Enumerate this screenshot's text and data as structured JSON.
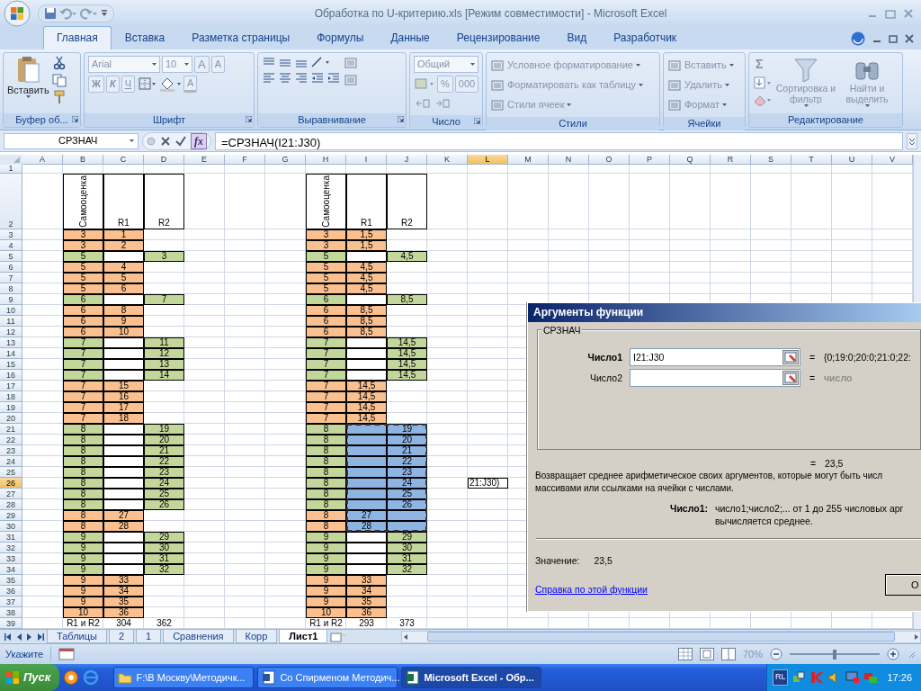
{
  "window": {
    "title": "Обработка по U-критерию.xls  [Режим совместимости] - Microsoft Excel"
  },
  "tabs": [
    {
      "label": "Главная",
      "selected": true
    },
    {
      "label": "Вставка",
      "selected": false
    },
    {
      "label": "Разметка страницы",
      "selected": false
    },
    {
      "label": "Формулы",
      "selected": false
    },
    {
      "label": "Данные",
      "selected": false
    },
    {
      "label": "Рецензирование",
      "selected": false
    },
    {
      "label": "Вид",
      "selected": false
    },
    {
      "label": "Разработчик",
      "selected": false
    }
  ],
  "ribbon": {
    "disabled": true,
    "clipboard": {
      "label": "Буфер об...",
      "paste": "Вставить"
    },
    "font": {
      "label": "Шрифт",
      "name": "Arial",
      "size": "10",
      "grow": "A",
      "shrink": "A",
      "bold": "Ж",
      "italic": "К",
      "underline": "Ч",
      "letter_button": "A"
    },
    "alignment": {
      "label": "Выравнивание"
    },
    "number": {
      "label": "Число",
      "format": "Общий",
      "percent": "%",
      "thousands": "000"
    },
    "styles": {
      "label": "Стили",
      "items": [
        "Условное форматирование",
        "Форматировать как таблицу",
        "Стили ячеек"
      ]
    },
    "cells": {
      "label": "Ячейки",
      "items": [
        "Вставить",
        "Удалить",
        "Формат"
      ]
    },
    "editing": {
      "label": "Редактирование",
      "sum": "Σ",
      "sort": "Сортировка и фильтр",
      "find": "Найти и выделить"
    }
  },
  "formula_bar": {
    "name_box": "СРЗНАЧ",
    "fx": "fx",
    "formula": "=СРЗНАЧ(I21:J30)"
  },
  "sheet": {
    "columns": [
      {
        "label": "A",
        "selected": false
      },
      {
        "label": "B",
        "selected": false
      },
      {
        "label": "C",
        "selected": false
      },
      {
        "label": "D",
        "selected": false
      },
      {
        "label": "E",
        "selected": false
      },
      {
        "label": "F",
        "selected": false
      },
      {
        "label": "G",
        "selected": false
      },
      {
        "label": "H",
        "selected": false
      },
      {
        "label": "I",
        "selected": false
      },
      {
        "label": "J",
        "selected": false
      },
      {
        "label": "K",
        "selected": false
      },
      {
        "label": "L",
        "selected": true
      },
      {
        "label": "M",
        "selected": false
      },
      {
        "label": "N",
        "selected": false
      },
      {
        "label": "O",
        "selected": false
      },
      {
        "label": "P",
        "selected": false
      },
      {
        "label": "Q",
        "selected": false
      },
      {
        "label": "R",
        "selected": false
      },
      {
        "label": "S",
        "selected": false
      },
      {
        "label": "T",
        "selected": false
      },
      {
        "label": "U",
        "selected": false
      },
      {
        "label": "V",
        "selected": false
      }
    ],
    "rows": [
      {
        "label": "1",
        "selected": false
      },
      {
        "label": "2",
        "selected": false
      },
      {
        "label": "3",
        "selected": false
      },
      {
        "label": "4",
        "selected": false
      },
      {
        "label": "5",
        "selected": false
      },
      {
        "label": "6",
        "selected": false
      },
      {
        "label": "7",
        "selected": false
      },
      {
        "label": "8",
        "selected": false
      },
      {
        "label": "9",
        "selected": false
      },
      {
        "label": "10",
        "selected": false
      },
      {
        "label": "11",
        "selected": false
      },
      {
        "label": "12",
        "selected": false
      },
      {
        "label": "13",
        "selected": false
      },
      {
        "label": "14",
        "selected": false
      },
      {
        "label": "15",
        "selected": false
      },
      {
        "label": "16",
        "selected": false
      },
      {
        "label": "17",
        "selected": false
      },
      {
        "label": "18",
        "selected": false
      },
      {
        "label": "19",
        "selected": false
      },
      {
        "label": "20",
        "selected": false
      },
      {
        "label": "21",
        "selected": false
      },
      {
        "label": "22",
        "selected": false
      },
      {
        "label": "23",
        "selected": false
      },
      {
        "label": "24",
        "selected": false
      },
      {
        "label": "25",
        "selected": false
      },
      {
        "label": "26",
        "selected": true
      },
      {
        "label": "27",
        "selected": false
      },
      {
        "label": "28",
        "selected": false
      },
      {
        "label": "29",
        "selected": false
      },
      {
        "label": "30",
        "selected": false
      },
      {
        "label": "31",
        "selected": false
      },
      {
        "label": "32",
        "selected": false
      },
      {
        "label": "33",
        "selected": false
      },
      {
        "label": "34",
        "selected": false
      },
      {
        "label": "35",
        "selected": false
      },
      {
        "label": "36",
        "selected": false
      },
      {
        "label": "37",
        "selected": false
      },
      {
        "label": "38",
        "selected": false
      },
      {
        "label": "39",
        "selected": false
      }
    ],
    "cell_echo": "21:J30)"
  },
  "tables": [
    {
      "headers": [
        "Самооценка",
        "R1",
        "R2"
      ],
      "rows": [
        {
          "kind": "r1",
          "score": "3",
          "rank": "1"
        },
        {
          "kind": "r1",
          "score": "3",
          "rank": "2"
        },
        {
          "kind": "r2",
          "score": "5",
          "rank": "3"
        },
        {
          "kind": "r1",
          "score": "5",
          "rank": "4"
        },
        {
          "kind": "r1",
          "score": "5",
          "rank": "5"
        },
        {
          "kind": "r1",
          "score": "5",
          "rank": "6"
        },
        {
          "kind": "r2",
          "score": "6",
          "rank": "7"
        },
        {
          "kind": "r1",
          "score": "6",
          "rank": "8"
        },
        {
          "kind": "r1",
          "score": "6",
          "rank": "9"
        },
        {
          "kind": "r1",
          "score": "6",
          "rank": "10"
        },
        {
          "kind": "r2",
          "score": "7",
          "rank": "11"
        },
        {
          "kind": "r2",
          "score": "7",
          "rank": "12"
        },
        {
          "kind": "r2",
          "score": "7",
          "rank": "13"
        },
        {
          "kind": "r2",
          "score": "7",
          "rank": "14"
        },
        {
          "kind": "r1",
          "score": "7",
          "rank": "15"
        },
        {
          "kind": "r1",
          "score": "7",
          "rank": "16"
        },
        {
          "kind": "r1",
          "score": "7",
          "rank": "17"
        },
        {
          "kind": "r1",
          "score": "7",
          "rank": "18"
        },
        {
          "kind": "r2",
          "score": "8",
          "rank": "19"
        },
        {
          "kind": "r2",
          "score": "8",
          "rank": "20"
        },
        {
          "kind": "r2",
          "score": "8",
          "rank": "21"
        },
        {
          "kind": "r2",
          "score": "8",
          "rank": "22"
        },
        {
          "kind": "r2",
          "score": "8",
          "rank": "23"
        },
        {
          "kind": "r2",
          "score": "8",
          "rank": "24"
        },
        {
          "kind": "r2",
          "score": "8",
          "rank": "25"
        },
        {
          "kind": "r2",
          "score": "8",
          "rank": "26"
        },
        {
          "kind": "r1",
          "score": "8",
          "rank": "27"
        },
        {
          "kind": "r1",
          "score": "8",
          "rank": "28"
        },
        {
          "kind": "r2",
          "score": "9",
          "rank": "29"
        },
        {
          "kind": "r2",
          "score": "9",
          "rank": "30"
        },
        {
          "kind": "r2",
          "score": "9",
          "rank": "31"
        },
        {
          "kind": "r2",
          "score": "9",
          "rank": "32"
        },
        {
          "kind": "r1",
          "score": "9",
          "rank": "33"
        },
        {
          "kind": "r1",
          "score": "9",
          "rank": "34"
        },
        {
          "kind": "r1",
          "score": "9",
          "rank": "35"
        },
        {
          "kind": "r1",
          "score": "10",
          "rank": "36"
        }
      ],
      "totals": [
        "R1 и R2",
        "304",
        "362"
      ]
    },
    {
      "headers": [
        "Самооценка",
        "R1",
        "R2"
      ],
      "rows": [
        {
          "kind": "r1",
          "score": "3",
          "rank": "1,5",
          "highlighted": false
        },
        {
          "kind": "r1",
          "score": "3",
          "rank": "1,5",
          "highlighted": false
        },
        {
          "kind": "r2",
          "score": "5",
          "rank": "4,5",
          "highlighted": false
        },
        {
          "kind": "r1",
          "score": "5",
          "rank": "4,5",
          "highlighted": false
        },
        {
          "kind": "r1",
          "score": "5",
          "rank": "4,5",
          "highlighted": false
        },
        {
          "kind": "r1",
          "score": "5",
          "rank": "4,5",
          "highlighted": false
        },
        {
          "kind": "r2",
          "score": "6",
          "rank": "8,5",
          "highlighted": false
        },
        {
          "kind": "r1",
          "score": "6",
          "rank": "8,5",
          "highlighted": false
        },
        {
          "kind": "r1",
          "score": "6",
          "rank": "8,5",
          "highlighted": false
        },
        {
          "kind": "r1",
          "score": "6",
          "rank": "8,5",
          "highlighted": false
        },
        {
          "kind": "r2",
          "score": "7",
          "rank": "14,5",
          "highlighted": false
        },
        {
          "kind": "r2",
          "score": "7",
          "rank": "14,5",
          "highlighted": false
        },
        {
          "kind": "r2",
          "score": "7",
          "rank": "14,5",
          "highlighted": false
        },
        {
          "kind": "r2",
          "score": "7",
          "rank": "14,5",
          "highlighted": false
        },
        {
          "kind": "r1",
          "score": "7",
          "rank": "14,5",
          "highlighted": false
        },
        {
          "kind": "r1",
          "score": "7",
          "rank": "14,5",
          "highlighted": false
        },
        {
          "kind": "r1",
          "score": "7",
          "rank": "14,5",
          "highlighted": false
        },
        {
          "kind": "r1",
          "score": "7",
          "rank": "14,5",
          "highlighted": false
        },
        {
          "kind": "r2",
          "score": "8",
          "rank": "19",
          "highlighted": true
        },
        {
          "kind": "r2",
          "score": "8",
          "rank": "20",
          "highlighted": true
        },
        {
          "kind": "r2",
          "score": "8",
          "rank": "21",
          "highlighted": true
        },
        {
          "kind": "r2",
          "score": "8",
          "rank": "22",
          "highlighted": true
        },
        {
          "kind": "r2",
          "score": "8",
          "rank": "23",
          "highlighted": true
        },
        {
          "kind": "r2",
          "score": "8",
          "rank": "24",
          "highlighted": true
        },
        {
          "kind": "r2",
          "score": "8",
          "rank": "25",
          "highlighted": true
        },
        {
          "kind": "r2",
          "score": "8",
          "rank": "26",
          "highlighted": true
        },
        {
          "kind": "r1",
          "score": "8",
          "rank": "27",
          "highlighted": true
        },
        {
          "kind": "r1",
          "score": "8",
          "rank": "28",
          "highlighted": true
        },
        {
          "kind": "r2",
          "score": "9",
          "rank": "29",
          "highlighted": false
        },
        {
          "kind": "r2",
          "score": "9",
          "rank": "30",
          "highlighted": false
        },
        {
          "kind": "r2",
          "score": "9",
          "rank": "31",
          "highlighted": false
        },
        {
          "kind": "r2",
          "score": "9",
          "rank": "32",
          "highlighted": false
        },
        {
          "kind": "r1",
          "score": "9",
          "rank": "33",
          "highlighted": false
        },
        {
          "kind": "r1",
          "score": "9",
          "rank": "34",
          "highlighted": false
        },
        {
          "kind": "r1",
          "score": "9",
          "rank": "35",
          "highlighted": false
        },
        {
          "kind": "r1",
          "score": "10",
          "rank": "36",
          "highlighted": false
        }
      ],
      "totals": [
        "R1 и R2",
        "293",
        "373"
      ]
    }
  ],
  "dialog": {
    "title": "Аргументы функции",
    "function": "СРЗНАЧ",
    "args": [
      {
        "label": "Число1",
        "value": "I21:J30",
        "sign": "=",
        "result": "{0;19:0;20:0;21:0;22:",
        "active": true
      },
      {
        "label": "Число2",
        "sign": "=",
        "result": "число",
        "active": false
      }
    ],
    "total_sign": "=",
    "total": "23,5",
    "description_lines": [
      "Возвращает среднее арифметическое своих аргументов, которые могут быть числ",
      "массивами или ссылками на ячейки с числами."
    ],
    "arg_help_label": "Число1:",
    "arg_help_lines": [
      "число1;число2;... от 1 до 255 числовых арг",
      "вычисляется среднее."
    ],
    "value_label": "Значение:",
    "value": "23,5",
    "help_link": "Справка по этой функции",
    "ok": "О"
  },
  "sheet_tabs": [
    {
      "label": "Таблицы",
      "selected": false
    },
    {
      "label": "2",
      "selected": false
    },
    {
      "label": "1",
      "selected": false
    },
    {
      "label": "Сравнения",
      "selected": false
    },
    {
      "label": "Корр",
      "selected": false
    },
    {
      "label": "Лист1",
      "selected": true
    }
  ],
  "status_bar": {
    "mode": "Укажите",
    "zoom": "70%",
    "zoom_disabled": true,
    "level": 0.5
  },
  "taskbar": {
    "start": "Пуск",
    "tasks": [
      {
        "label": "F:\\В Москву\\Методичк...",
        "kind": "folder",
        "selected": false
      },
      {
        "label": "Со Спирменом Методич...",
        "kind": "word",
        "selected": false
      },
      {
        "label": "Microsoft Excel - Обр...",
        "kind": "excel",
        "selected": true
      }
    ],
    "language": "RL",
    "clock": "17:26"
  }
}
